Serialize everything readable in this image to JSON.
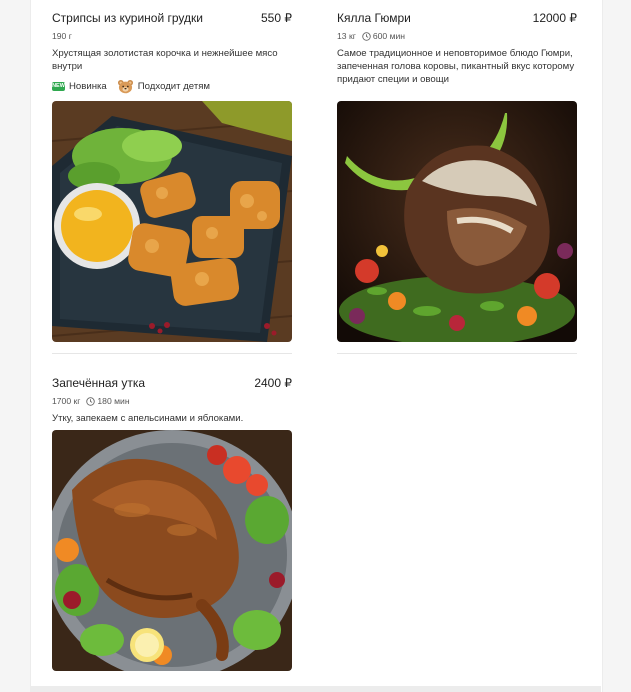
{
  "menu": {
    "items": [
      {
        "title": "Стрипсы из куриной грудки",
        "price": "550 ₽",
        "weight": "190 г",
        "description": "Хрустящая золотистая корочка и нежнейшее мясо внутри",
        "badges": [
          {
            "label": "Новинка",
            "icon": "new-icon",
            "icon_text": "NEW"
          },
          {
            "label": "Подходит детям",
            "icon": "bear-icon"
          }
        ]
      },
      {
        "title": "Кялла Гюмри",
        "price": "12000 ₽",
        "weight": "13 кг",
        "time": "600 мин",
        "description": "Самое традиционное и неповторимое блюдо Гюмри, запеченная голова коровы, пикантный вкус которому придают специи и овощи"
      },
      {
        "title": "Запечённая утка",
        "price": "2400 ₽",
        "weight": "1700 кг",
        "time": "180 мин",
        "description": "Утку, запекаем с апельсинами и яблоками."
      }
    ]
  },
  "colors": {
    "new_badge": "#2fa84f",
    "divider": "#e6e6e6",
    "page_background": "#f5f5f5"
  }
}
